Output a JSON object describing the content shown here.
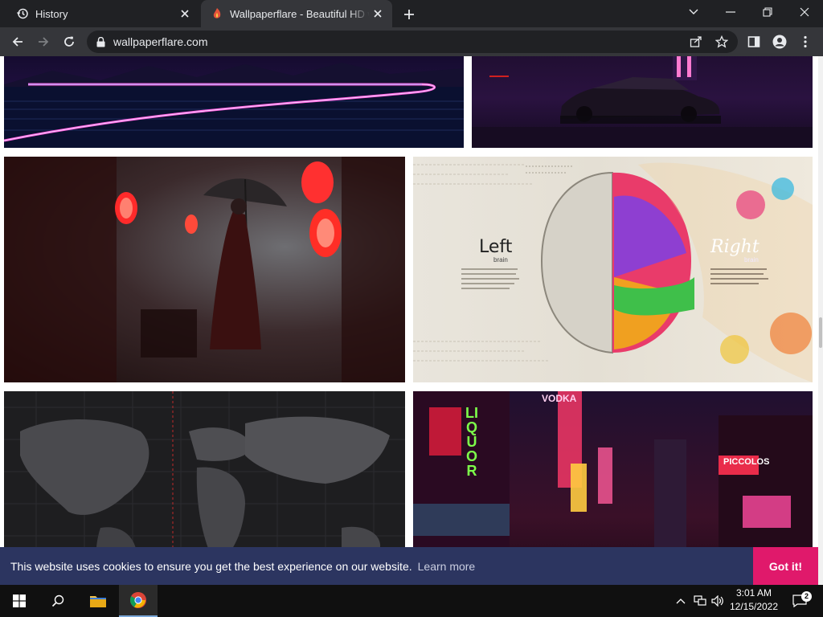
{
  "browser": {
    "tabs": [
      {
        "title": "History",
        "icon": "history-icon",
        "active": false
      },
      {
        "title": "Wallpaperflare - Beautiful HD wallpapers",
        "icon": "wallpaperflare-favicon",
        "active": true
      }
    ],
    "address": "wallpaperflare.com"
  },
  "page": {
    "wallpapers": [
      {
        "subject": "retrowave-neon-road"
      },
      {
        "subject": "dark-muscle-car"
      },
      {
        "subject": "girl-with-umbrella-red-lanterns"
      },
      {
        "subject": "left-right-brain",
        "left_heading": "Left",
        "left_sub": "brain",
        "right_heading": "Right",
        "right_sub": "brain"
      },
      {
        "subject": "dark-world-map"
      },
      {
        "subject": "neon-city-street",
        "signs": [
          "LIQUOR",
          "PICCOLOS",
          "VODKA"
        ]
      }
    ],
    "cookie": {
      "message": "This website uses cookies to ensure you get the best experience on our website.",
      "learn_more": "Learn more",
      "accept": "Got it!"
    }
  },
  "taskbar": {
    "time": "3:01 AM",
    "date": "12/15/2022",
    "notification_count": "2"
  },
  "colors": {
    "tabstrip": "#202124",
    "toolbar": "#35363a",
    "cookie_bar": "#2c3560",
    "accept_button": "#e0196b",
    "taskbar": "#101010"
  }
}
